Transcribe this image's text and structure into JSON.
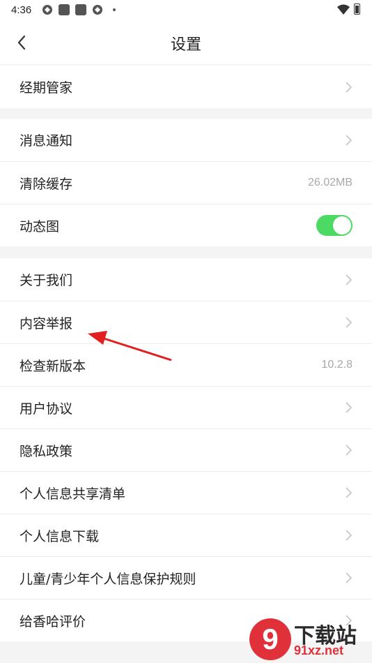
{
  "status_bar": {
    "time": "4:36",
    "icons": [
      "sync-icon",
      "app-icon",
      "app-icon",
      "sync-icon",
      "dot-icon",
      "wifi-icon",
      "battery-icon"
    ]
  },
  "header": {
    "title": "设置",
    "back_icon": "chevron-left-icon"
  },
  "sections": [
    {
      "items": [
        {
          "label": "经期管家",
          "type": "link"
        }
      ]
    },
    {
      "items": [
        {
          "label": "消息通知",
          "type": "link"
        },
        {
          "label": "清除缓存",
          "type": "value",
          "value": "26.02MB"
        },
        {
          "label": "动态图",
          "type": "toggle",
          "on": true
        }
      ]
    },
    {
      "items": [
        {
          "label": "关于我们",
          "type": "link"
        },
        {
          "label": "内容举报",
          "type": "link"
        },
        {
          "label": "检查新版本",
          "type": "value",
          "value": "10.2.8"
        },
        {
          "label": "用户协议",
          "type": "link"
        },
        {
          "label": "隐私政策",
          "type": "link"
        },
        {
          "label": "个人信息共享清单",
          "type": "link"
        },
        {
          "label": "个人信息下载",
          "type": "link"
        },
        {
          "label": "儿童/青少年个人信息保护规则",
          "type": "link"
        },
        {
          "label": "给香哈评价",
          "type": "link"
        }
      ]
    }
  ],
  "annotation": {
    "color": "#e02020"
  },
  "watermark": {
    "logo": "9",
    "title": "下载站",
    "url": "91xz.net"
  },
  "colors": {
    "toggle_on": "#4cd964",
    "divider_bg": "#f4f4f4"
  }
}
